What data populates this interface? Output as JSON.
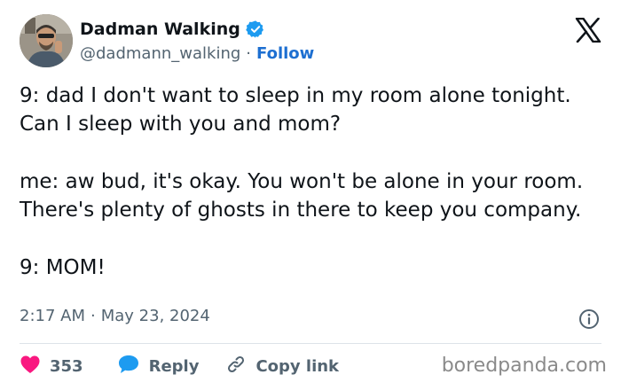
{
  "author": {
    "display_name": "Dadman Walking",
    "handle": "@dadmann_walking",
    "separator": "·",
    "follow_label": "Follow",
    "verified_icon": "verified-badge-icon",
    "verified_color": "#1d9bf0"
  },
  "platform_logo": "x-logo-icon",
  "tweet": {
    "paragraphs": [
      "9: dad I don't want to sleep in my room alone tonight. Can I sleep with you and mom?",
      "me: aw bud, it's okay. You won't be alone in your room. There's plenty of ghosts in there to keep you company.",
      "9: MOM!"
    ]
  },
  "meta": {
    "time": "2:17 AM",
    "separator": "·",
    "date": "May 23, 2024"
  },
  "actions": {
    "like_count": "353",
    "reply_label": "Reply",
    "copy_link_label": "Copy link"
  },
  "watermark": "boredpanda.com",
  "colors": {
    "like": "#f91880",
    "reply": "#1d9bf0",
    "link": "#1d6fd1",
    "muted": "#536471"
  }
}
